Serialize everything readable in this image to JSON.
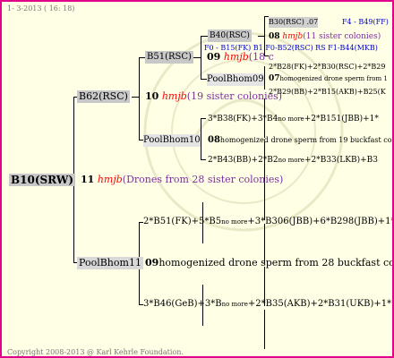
{
  "header": {
    "date": "1-  3-2013 ( 16: 18)"
  },
  "footer": {
    "copyright": "Copyright 2008-2013 @ Karl Kehrle Foundation."
  },
  "root": {
    "id": "B10(SRW)",
    "year": "11",
    "breeder": "hmjb",
    "note": "(Drones from 28 sister colonies)"
  },
  "mother": {
    "id": "B62(RSC)",
    "year": "10",
    "breeder": "hmjb",
    "note": "(19 sister colonies)"
  },
  "father": {
    "id": "PoolBhom11",
    "year": "09",
    "note": "homogenized drone sperm from 28 buckfast colo"
  },
  "grandmother": {
    "id": "B51(RSC)",
    "year": "09",
    "breeder": "hmjb",
    "note": "(18 c"
  },
  "grandfather": {
    "id": "PoolBhom10",
    "year": "08",
    "note": "homogenized drone sperm from 19 buckfast co"
  },
  "ggm": {
    "id": "B40(RSC)",
    "year": "08",
    "breeder": "hmjb",
    "note": "(11 sister colonies)"
  },
  "ggm_mother": {
    "id": "B30(RSC)",
    "year": ".07",
    "extra": "F4 - B49(FF)"
  },
  "ggm_father_line": "F0 - B15(FK) B1 F0-B52(RSC) RS F1-B44(MKB)",
  "ggf": {
    "id": "PoolBhom09",
    "year": "07",
    "note": "homogenized drone sperm from 1"
  },
  "combos": {
    "c1": "2*B28(FK)+2*B30(RSC)+2*B29",
    "c2": "2*B29(BB)+2*B15(AKB)+B25(K",
    "c3": "3*B38(FK)+3*B4",
    "c3b": "+2*B151(JBB)+1*",
    "c4": "2*B43(BB)+2*B2",
    "c4b": "+2*B33(LKB)+B3",
    "c5": "2*B51(FK)+5*B5",
    "c5b": "+3*B306(JBB)+6*B298(JBB)+1*",
    "c6": "3*B46(GeB)+3*B",
    "c6b": "+2*B35(AKB)+2*B31(UKB)+1*",
    "nomore": "no more"
  }
}
